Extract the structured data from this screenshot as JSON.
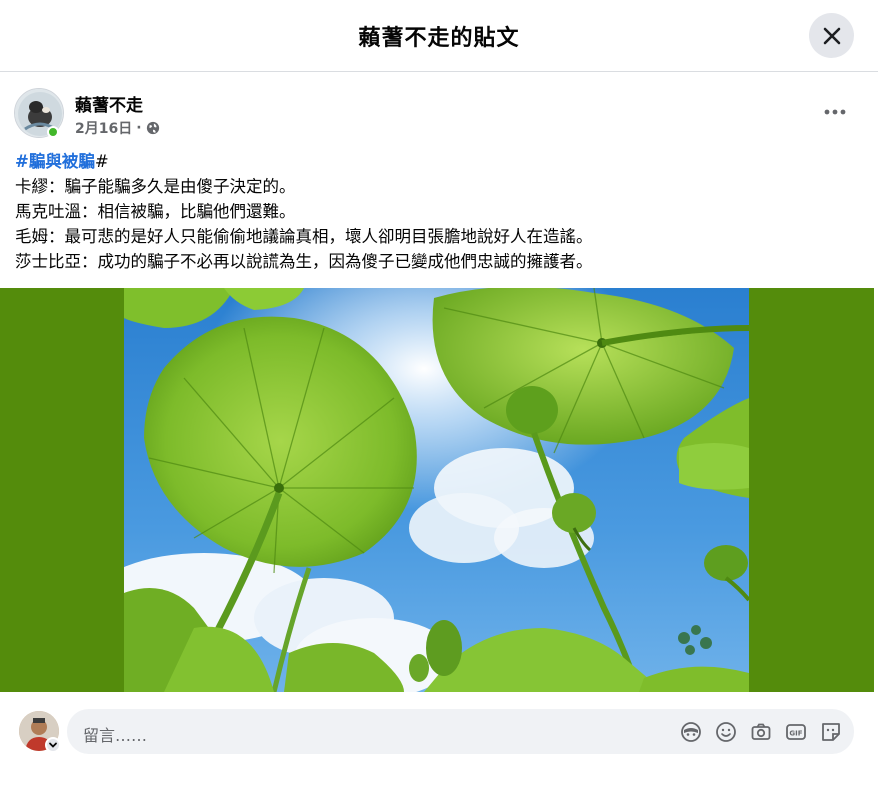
{
  "dialog": {
    "title": "藾蓍不走的貼文",
    "close_icon": "close-icon"
  },
  "post": {
    "author": "藾蓍不走",
    "date": "2月16日",
    "separator": "·",
    "privacy_icon": "globe-icon",
    "more_icon": "more-horizontal-icon",
    "hashtag": "#騙與被騙",
    "hashtag_suffix": "#",
    "lines": [
      "卡繆：騙子能騙多久是由傻子決定的。",
      "馬克吐溫：相信被騙，比騙他們還難。",
      "毛姆：最可悲的是好人只能偷偷地議論真相，壞人卻明目張膽地說好人在造謠。",
      "莎士比亞：成功的騙子不必再以說謊為生，因為傻子已變成他們忠誠的擁護者。"
    ],
    "photo": "lotus-leaves-under-blue-sky-photo"
  },
  "comment": {
    "placeholder": "留言……",
    "icons": [
      "avatar-sticker-icon",
      "emoji-icon",
      "camera-icon",
      "gif-icon",
      "sticker-icon"
    ]
  },
  "colors": {
    "hashtag": "#216fdb",
    "photo_background": "#548c0c",
    "input_background": "#f0f2f5"
  }
}
